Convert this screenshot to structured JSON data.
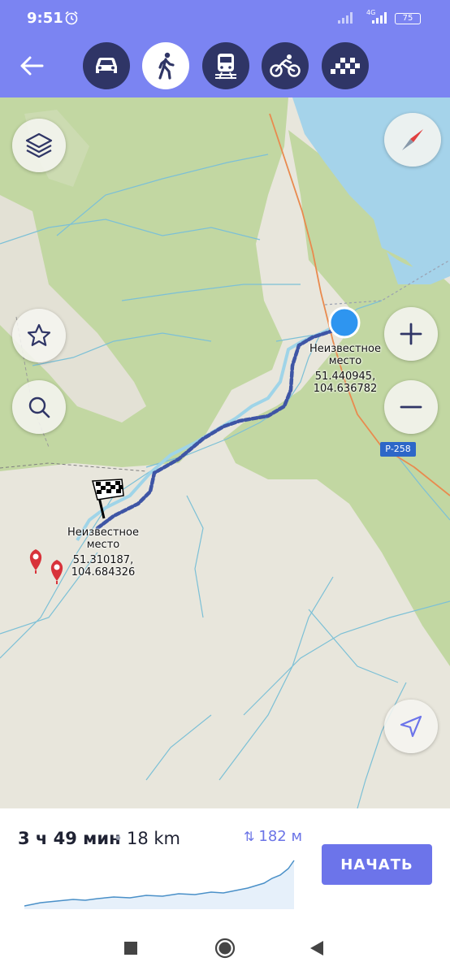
{
  "status_bar": {
    "time": "9:51",
    "network": "4G",
    "battery": "75"
  },
  "transport_modes": [
    {
      "name": "car",
      "active": false
    },
    {
      "name": "walk",
      "active": true
    },
    {
      "name": "train",
      "active": false
    },
    {
      "name": "bike",
      "active": false
    },
    {
      "name": "taxi",
      "active": false
    }
  ],
  "map": {
    "road_label": "Р-258",
    "current_location": {
      "name_line1": "Неизвестное",
      "name_line2": "место",
      "coords_line1": "51.440945,",
      "coords_line2": "104.636782"
    },
    "destination": {
      "name_line1": "Неизвестное",
      "name_line2": "место",
      "coords_line1": "51.310187,",
      "coords_line2": "104.684326"
    }
  },
  "route": {
    "duration": "3 ч 49 мин",
    "separator": "•",
    "distance": "18 km",
    "elevation_arrows": "⇅",
    "elevation": "182 м",
    "start_label": "НАЧАТЬ"
  },
  "colors": {
    "accent": "#7b84f2",
    "button": "#6c74ea",
    "location": "#2e95f0",
    "water": "#a5d3ea",
    "forest": "#c2d7a2",
    "route": "#3e55a5"
  }
}
